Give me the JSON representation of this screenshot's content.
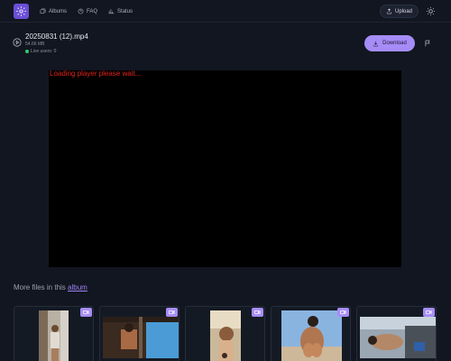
{
  "header": {
    "nav": [
      {
        "label": "Albums",
        "icon": "albums-icon"
      },
      {
        "label": "FAQ",
        "icon": "faq-icon"
      },
      {
        "label": "Status",
        "icon": "status-icon"
      }
    ],
    "upload_label": "Upload"
  },
  "file": {
    "name": "20250831 (12).mp4",
    "size": "54.66 MB",
    "live_users": "Live users: 0"
  },
  "actions": {
    "download_label": "Download"
  },
  "player": {
    "message": "Loading player please wait..."
  },
  "more_files": {
    "prefix": "More files in this",
    "link": "album"
  },
  "colors": {
    "background": "#121620",
    "accent": "#a68cf7",
    "logo": "#6b4fd6",
    "live_dot": "#2ecc71",
    "player_message": "#e0241d"
  },
  "thumbnails": [
    {
      "type": "video",
      "badge_icon": "video-icon"
    },
    {
      "type": "video",
      "badge_icon": "video-icon"
    },
    {
      "type": "video",
      "badge_icon": "video-icon"
    },
    {
      "type": "video",
      "badge_icon": "video-icon"
    },
    {
      "type": "video",
      "badge_icon": "video-icon"
    }
  ]
}
